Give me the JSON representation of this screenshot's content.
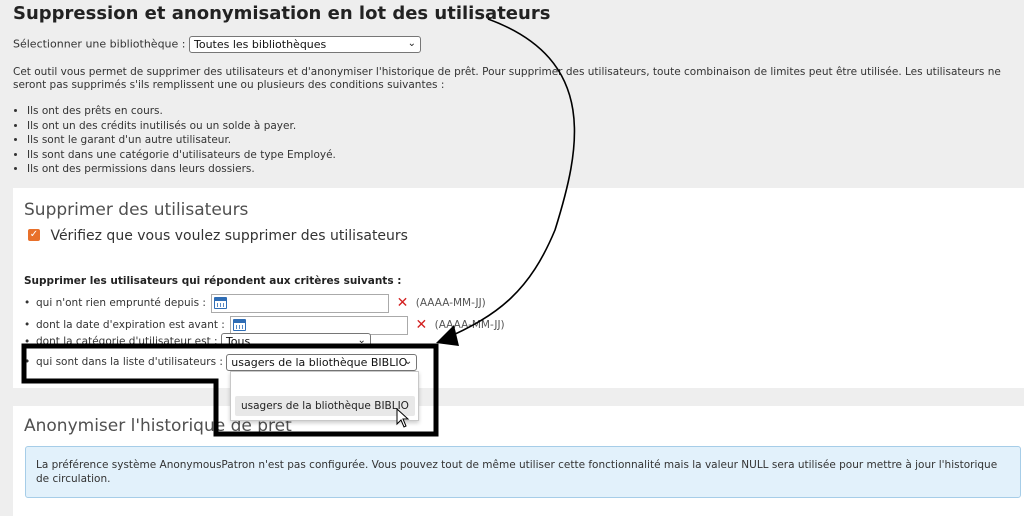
{
  "page": {
    "title": "Suppression et anonymisation en lot des utilisateurs"
  },
  "library": {
    "label": "Sélectionner une bibliothèque :",
    "selected": "Toutes les bibliothèques"
  },
  "intro": {
    "text": "Cet outil vous permet de supprimer des utilisateurs et d'anonymiser l'historique de prêt. Pour supprimer des utilisateurs, toute combinaison de limites peut être utilisée. Les utilisateurs ne seront pas supprimés s'ils remplissent une ou plusieurs des conditions suivantes :",
    "conditions": [
      "Ils ont des prêts en cours.",
      "Ils ont un des crédits inutilisés ou un solde à payer.",
      "Ils sont le garant d'un autre utilisateur.",
      "Ils sont dans une catégorie d'utilisateurs de type Employé.",
      "Ils ont des permissions dans leurs dossiers."
    ]
  },
  "delete_section": {
    "heading": "Supprimer des utilisateurs",
    "verify_label": "Vérifiez que vous voulez supprimer des utilisateurs",
    "verify_checked": true,
    "criteria_title": "Supprimer les utilisateurs qui répondent aux critères suivants :",
    "not_borrowed_label": "qui n'ont rien emprunté depuis :",
    "not_borrowed_value": "",
    "expiry_label": "dont la date d'expiration est avant :",
    "expiry_value": "",
    "date_hint": "(AAAA-MM-JJ)",
    "category_label": "dont la catégorie d'utilisateur est :",
    "category_selected": "Tous",
    "patron_list_label": "qui sont dans la liste d'utilisateurs :",
    "patron_list_selected": "usagers de la bliothèque BIBLIO",
    "patron_list_options": [
      "",
      "usagers de la bliothèque BIBLIO"
    ]
  },
  "anon_section": {
    "heading": "Anonymiser l'historique de prêt",
    "alert": "La préférence système AnonymousPatron n'est pas configurée. Vous pouvez tout de même utiliser cette fonctionnalité mais la valeur NULL sera utilisée pour mettre à jour l'historique de circulation."
  },
  "colors": {
    "accent_checkbox": "#e8702a",
    "clear_icon": "#d32020",
    "calendar_icon": "#2f6db5",
    "alert_bg": "#e2f1fb",
    "annotation": "#000000"
  }
}
